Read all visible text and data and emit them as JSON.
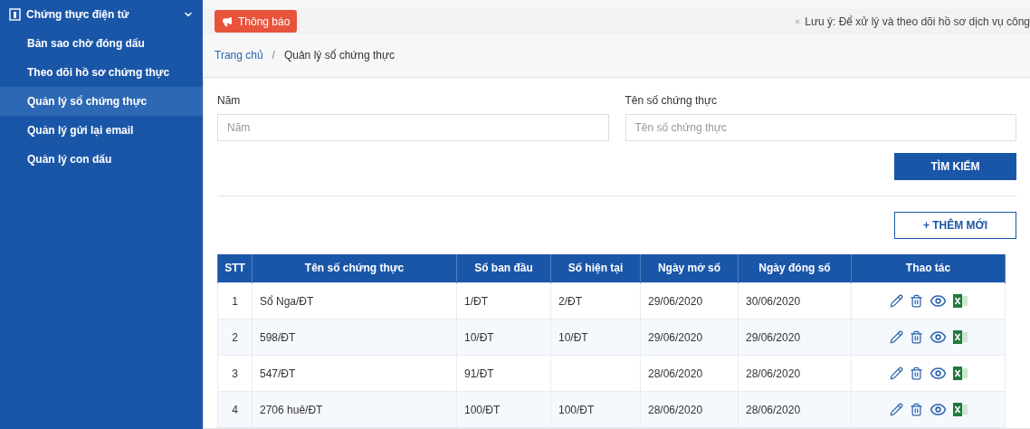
{
  "sidebar": {
    "group": {
      "label": "Chứng thực điện tử",
      "expanded": true
    },
    "items": [
      {
        "label": "Bản sao chờ đóng dấu",
        "selected": false
      },
      {
        "label": "Theo dõi hồ sơ chứng thực",
        "selected": false
      },
      {
        "label": "Quản lý sổ chứng thực",
        "selected": true
      },
      {
        "label": "Quản lý gửi lại email",
        "selected": false
      },
      {
        "label": "Quản lý con dấu",
        "selected": false
      }
    ]
  },
  "notice": {
    "badge": "Thông báo",
    "text": "Lưu ý: Để xử lý và theo dõi hồ sơ dịch vụ công"
  },
  "breadcrumb": {
    "separator": "/",
    "items": [
      "Trang chủ",
      "Quản lý sổ chứng thực"
    ]
  },
  "filters": [
    {
      "label": "Năm",
      "placeholder": "Năm"
    },
    {
      "label": "Tên số chứng thực",
      "placeholder": "Tên số chứng thực"
    }
  ],
  "search_button": "TÌM KIẾM",
  "add_button": "+ THÊM MỚI",
  "table": {
    "columns": [
      "STT",
      "Tên số chứng thực",
      "Số ban đầu",
      "Số hiện tại",
      "Ngày mở số",
      "Ngày đóng số",
      "Thao tác"
    ],
    "rows": [
      [
        "1",
        "Sổ Nga/ĐT",
        "1/ĐT",
        "2/ĐT",
        "29/06/2020",
        "30/06/2020"
      ],
      [
        "2",
        "598/ĐT",
        "10/ĐT",
        "10/ĐT",
        "29/06/2020",
        "29/06/2020"
      ],
      [
        "3",
        "547/ĐT",
        "91/ĐT",
        "",
        "28/06/2020",
        "28/06/2020"
      ],
      [
        "4",
        "2706 huê/ĐT",
        "100/ĐT",
        "100/ĐT",
        "28/06/2020",
        "28/06/2020"
      ]
    ]
  }
}
